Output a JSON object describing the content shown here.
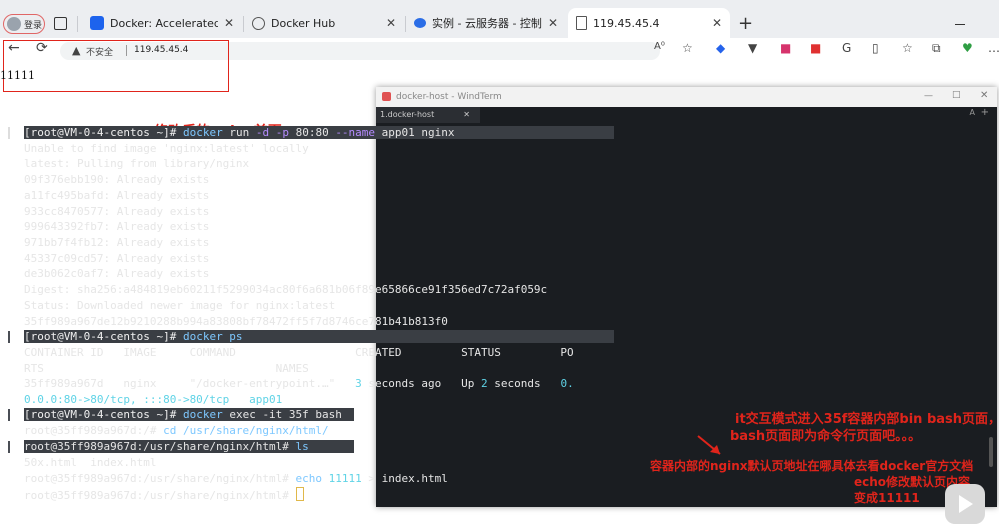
{
  "browser": {
    "profile_label": "登录",
    "tabs": [
      {
        "label": "Docker: Accelerated Container A"
      },
      {
        "label": "Docker Hub"
      },
      {
        "label": "实例 - 云服务器 - 控制台"
      },
      {
        "label": "119.45.45.4",
        "active": true
      }
    ],
    "new_tab": "+",
    "address": {
      "security": "不安全",
      "url": "119.45.45.4"
    }
  },
  "page": {
    "body_text": "11111"
  },
  "annotations": {
    "nginx_home": "修改后的nginx首页",
    "exec_note_1": "it交互模式进入35f容器内部bin bash页面，",
    "exec_note_2": "bash页面即为命令行页面吧。。。",
    "path_note": "容器内部的nginx默认页地址在哪具体去看docker官方文档",
    "echo_note_1": "echo修改默认页内容",
    "echo_note_2": "变成11111"
  },
  "terminal": {
    "window_title": "docker-host - WindTerm",
    "tab_label": "1.docker-host",
    "lines": {
      "run_prompt": "[root@VM-0-4-centos ~]# ",
      "run_cmd": "docker",
      "run_args": " run ",
      "run_flag_d": "-d",
      "run_space": " ",
      "run_flag_p": "-p",
      "run_port": " 80:80 ",
      "run_flag_name": "--name",
      "run_rest": " app01 nginx",
      "l2": "Unable to find image 'nginx:latest' locally",
      "l3": "latest: Pulling from library/nginx",
      "l4": "09f376ebb190: Already exists",
      "l5": "a11fc495bafd: Already exists",
      "l6": "933cc8470577: Already exists",
      "l7": "999643392fb7: Already exists",
      "l8": "971bb7f4fb12: Already exists",
      "l9": "45337c09cd57: Already exists",
      "l10": "de3b062c0af7: Already exists",
      "l11": "Digest: sha256:a484819eb60211f5299034ac80f6a681b06f89e65866ce91f356ed7c72af059c",
      "l12": "Status: Downloaded newer image for nginx:latest",
      "l13": "35ff989a967de12b9210288b994a83808bf78472ff5f7d8746ce781b41b813f0",
      "ps_prompt": "[root@VM-0-4-centos ~]# ",
      "ps_cmd": "docker ps",
      "h1": "CONTAINER ID   IMAGE     COMMAND                  CREATED         STATUS         PO",
      "h2": "RTS                                   NAMES",
      "r1a": "35ff989a967d   nginx     \"/docker-entrypoint.…\"   ",
      "r1b": "3",
      "r1c": " seconds ago   Up ",
      "r1d": "2",
      "r1e": " seconds   ",
      "r1f": "0.",
      "r2a": "0.0.0:80->80/tcp, :::80->80/tcp   app01",
      "exec_prompt": "[root@VM-0-4-centos ~]# ",
      "exec_cmd": "docker",
      "exec_rest": " exec -it 35f bash",
      "cd_prompt": "root@35ff989a967d:/# ",
      "cd_cmd": "cd /usr/share/nginx/html/",
      "ls_prompt": "root@35ff989a967d:/usr/share/nginx/html# ",
      "ls_cmd": "ls",
      "ls_out": "50x.html  index.html",
      "echo_prompt": "root@35ff989a967d:/usr/share/nginx/html# ",
      "echo_cmd": "echo",
      "echo_num": " 11111",
      "echo_rest": " > index.html",
      "final_prompt": "root@35ff989a967d:/usr/share/nginx/html# "
    }
  }
}
